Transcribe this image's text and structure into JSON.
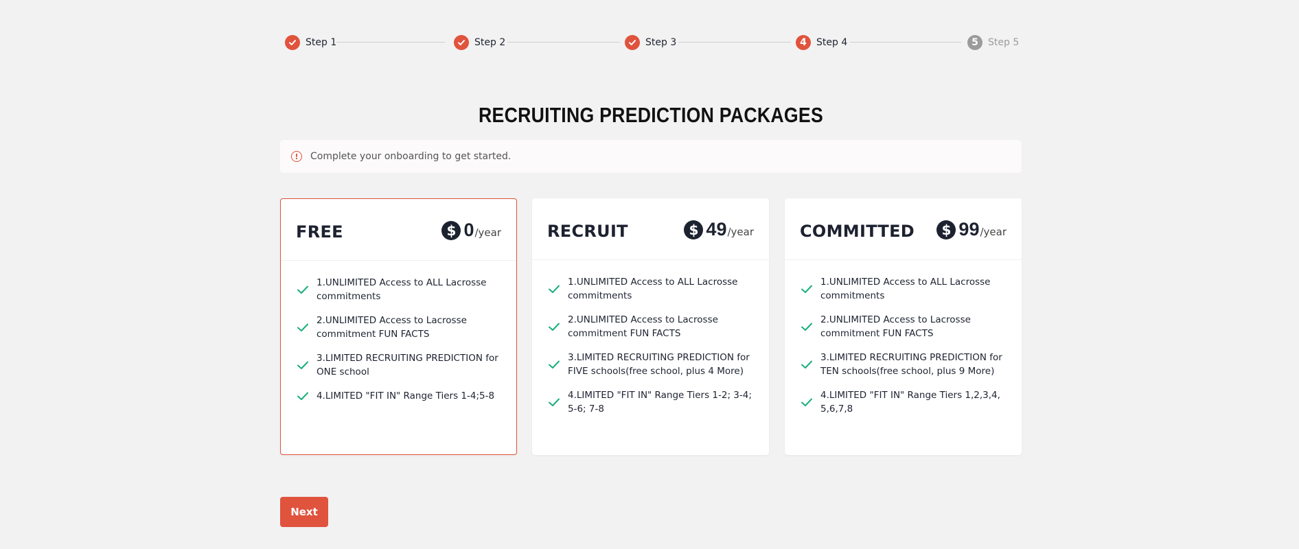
{
  "stepper": {
    "steps": [
      {
        "label": "Step 1",
        "status": "done",
        "number": "1"
      },
      {
        "label": "Step 2",
        "status": "done",
        "number": "2"
      },
      {
        "label": "Step 3",
        "status": "done",
        "number": "3"
      },
      {
        "label": "Step 4",
        "status": "current",
        "number": "4"
      },
      {
        "label": "Step 5",
        "status": "pending",
        "number": "5"
      }
    ]
  },
  "title": "RECRUITING PREDICTION PACKAGES",
  "alert": {
    "icon": "alert-circle-icon",
    "text": "Complete your onboarding to get started."
  },
  "packages": [
    {
      "name": "FREE",
      "price": "0",
      "period": "/year",
      "selected": true,
      "features": [
        "1.UNLIMITED Access to ALL Lacrosse commitments",
        "2.UNLIMITED Access to Lacrosse commitment FUN FACTS",
        "3.LIMITED RECRUITING PREDICTION for ONE school",
        "4.LIMITED \"FIT IN\" Range Tiers 1-4;5-8"
      ]
    },
    {
      "name": "RECRUIT",
      "price": "49",
      "period": "/year",
      "selected": false,
      "features": [
        "1.UNLIMITED Access to ALL Lacrosse commitments",
        "2.UNLIMITED Access to Lacrosse commitment FUN FACTS",
        "3.LIMITED RECRUITING PREDICTION for FIVE schools(free school, plus 4 More)",
        "4.LIMITED \"FIT IN\" Range Tiers 1-2; 3-4; 5-6; 7-8"
      ]
    },
    {
      "name": "COMMITTED",
      "price": "99",
      "period": "/year",
      "selected": false,
      "features": [
        "1.UNLIMITED Access to ALL Lacrosse commitments",
        "2.UNLIMITED Access to Lacrosse commitment FUN FACTS",
        "3.LIMITED RECRUITING PREDICTION for TEN schools(free school, plus 9 More)",
        "4.LIMITED \"FIT IN\" Range Tiers 1,2,3,4, 5,6,7,8"
      ]
    }
  ],
  "next_label": "Next",
  "colors": {
    "accent": "#e0533d",
    "check": "#1aae7a",
    "pending": "#9b9b9b"
  }
}
